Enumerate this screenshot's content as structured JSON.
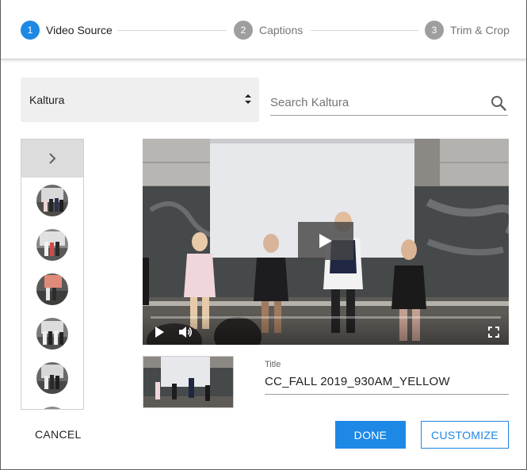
{
  "stepper": {
    "steps": [
      {
        "number": "1",
        "label": "Video Source",
        "state": "active"
      },
      {
        "number": "2",
        "label": "Captions",
        "state": "inactive"
      },
      {
        "number": "3",
        "label": "Trim & Crop",
        "state": "inactive"
      }
    ]
  },
  "source": {
    "selected": "Kaltura"
  },
  "search": {
    "placeholder": "Search Kaltura",
    "value": ""
  },
  "rail": {
    "expand_icon": "chevron-right-icon",
    "thumbnail_count": 6
  },
  "player": {
    "progress": 0.0,
    "play_icon": "play-icon",
    "volume_icon": "volume-icon",
    "fullscreen_icon": "fullscreen-icon"
  },
  "title_field": {
    "label": "Title",
    "value": "CC_FALL 2019_930AM_YELLOW"
  },
  "actions": {
    "cancel_label": "CANCEL",
    "done_label": "DONE",
    "customize_label": "CUSTOMIZE"
  },
  "colors": {
    "accent": "#1e88e5",
    "inactive_step": "#9e9e9e"
  }
}
